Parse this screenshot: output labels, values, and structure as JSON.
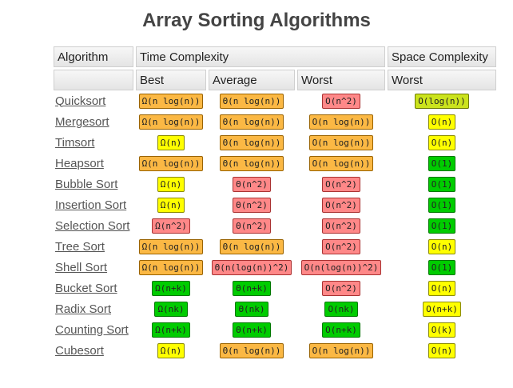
{
  "title": "Array Sorting Algorithms",
  "headers": {
    "algorithm": "Algorithm",
    "time": "Time Complexity",
    "space": "Space Complexity",
    "best": "Best",
    "average": "Average",
    "worst": "Worst",
    "space_worst": "Worst"
  },
  "colors": {
    "orange": "#fbb844",
    "yellow": "#ffff00",
    "red": "#ff8888",
    "green": "#00cc00",
    "lime": "#cbe31c"
  },
  "rows": [
    {
      "name": "Quicksort",
      "best": [
        "Ω(n log(n))",
        "orange"
      ],
      "avg": [
        "Θ(n log(n))",
        "orange"
      ],
      "worst": [
        "O(n^2)",
        "red"
      ],
      "space": [
        "O(log(n))",
        "lime"
      ]
    },
    {
      "name": "Mergesort",
      "best": [
        "Ω(n log(n))",
        "orange"
      ],
      "avg": [
        "Θ(n log(n))",
        "orange"
      ],
      "worst": [
        "O(n log(n))",
        "orange"
      ],
      "space": [
        "O(n)",
        "yellow"
      ]
    },
    {
      "name": "Timsort",
      "best": [
        "Ω(n)",
        "yellow"
      ],
      "avg": [
        "Θ(n log(n))",
        "orange"
      ],
      "worst": [
        "O(n log(n))",
        "orange"
      ],
      "space": [
        "O(n)",
        "yellow"
      ]
    },
    {
      "name": "Heapsort",
      "best": [
        "Ω(n log(n))",
        "orange"
      ],
      "avg": [
        "Θ(n log(n))",
        "orange"
      ],
      "worst": [
        "O(n log(n))",
        "orange"
      ],
      "space": [
        "O(1)",
        "green"
      ]
    },
    {
      "name": "Bubble Sort",
      "best": [
        "Ω(n)",
        "yellow"
      ],
      "avg": [
        "Θ(n^2)",
        "red"
      ],
      "worst": [
        "O(n^2)",
        "red"
      ],
      "space": [
        "O(1)",
        "green"
      ]
    },
    {
      "name": "Insertion Sort",
      "best": [
        "Ω(n)",
        "yellow"
      ],
      "avg": [
        "Θ(n^2)",
        "red"
      ],
      "worst": [
        "O(n^2)",
        "red"
      ],
      "space": [
        "O(1)",
        "green"
      ]
    },
    {
      "name": "Selection Sort",
      "best": [
        "Ω(n^2)",
        "red"
      ],
      "avg": [
        "Θ(n^2)",
        "red"
      ],
      "worst": [
        "O(n^2)",
        "red"
      ],
      "space": [
        "O(1)",
        "green"
      ]
    },
    {
      "name": "Tree Sort",
      "best": [
        "Ω(n log(n))",
        "orange"
      ],
      "avg": [
        "Θ(n log(n))",
        "orange"
      ],
      "worst": [
        "O(n^2)",
        "red"
      ],
      "space": [
        "O(n)",
        "yellow"
      ]
    },
    {
      "name": "Shell Sort",
      "best": [
        "Ω(n log(n))",
        "orange"
      ],
      "avg": [
        "Θ(n(log(n))^2)",
        "red"
      ],
      "worst": [
        "O(n(log(n))^2)",
        "red"
      ],
      "space": [
        "O(1)",
        "green"
      ]
    },
    {
      "name": "Bucket Sort",
      "best": [
        "Ω(n+k)",
        "green"
      ],
      "avg": [
        "Θ(n+k)",
        "green"
      ],
      "worst": [
        "O(n^2)",
        "red"
      ],
      "space": [
        "O(n)",
        "yellow"
      ]
    },
    {
      "name": "Radix Sort",
      "best": [
        "Ω(nk)",
        "green"
      ],
      "avg": [
        "Θ(nk)",
        "green"
      ],
      "worst": [
        "O(nk)",
        "green"
      ],
      "space": [
        "O(n+k)",
        "yellow"
      ]
    },
    {
      "name": "Counting Sort",
      "best": [
        "Ω(n+k)",
        "green"
      ],
      "avg": [
        "Θ(n+k)",
        "green"
      ],
      "worst": [
        "O(n+k)",
        "green"
      ],
      "space": [
        "O(k)",
        "yellow"
      ]
    },
    {
      "name": "Cubesort",
      "best": [
        "Ω(n)",
        "yellow"
      ],
      "avg": [
        "Θ(n log(n))",
        "orange"
      ],
      "worst": [
        "O(n log(n))",
        "orange"
      ],
      "space": [
        "O(n)",
        "yellow"
      ]
    }
  ]
}
